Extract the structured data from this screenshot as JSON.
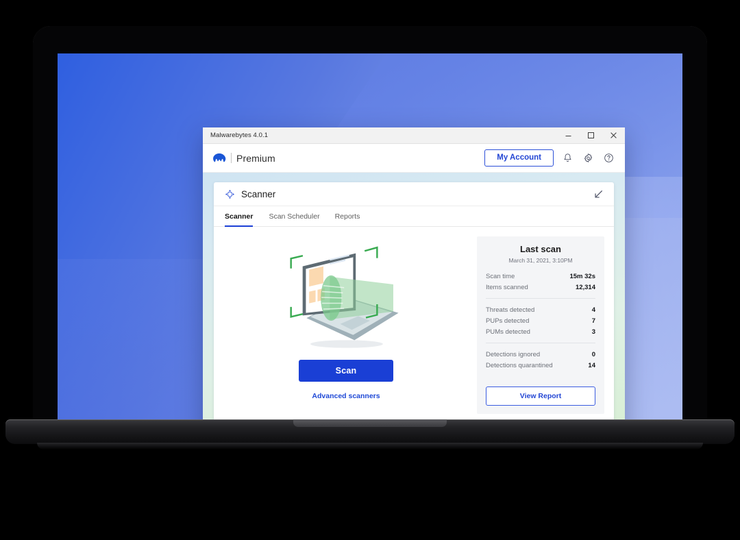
{
  "window": {
    "title": "Malwarebytes 4.0.1",
    "controls": {
      "minimize": "minimize-icon",
      "maximize": "maximize-icon",
      "close": "close-icon"
    }
  },
  "header": {
    "logo_icon": "malwarebytes-logo-icon",
    "edition": "Premium",
    "my_account_label": "My Account",
    "icons": {
      "notifications": "bell-icon",
      "settings": "gear-icon",
      "help": "help-circle-icon"
    }
  },
  "scanner_panel": {
    "icon": "scanner-target-icon",
    "title": "Scanner",
    "collapse_icon": "collapse-arrow-icon",
    "tabs": [
      {
        "label": "Scanner",
        "active": true
      },
      {
        "label": "Scan Scheduler",
        "active": false
      },
      {
        "label": "Reports",
        "active": false
      }
    ],
    "illustration": "laptop-scan-illustration",
    "scan_button_label": "Scan",
    "advanced_scanners_label": "Advanced scanners"
  },
  "last_scan": {
    "title": "Last scan",
    "timestamp": "March 31, 2021,  3:10PM",
    "groups": [
      {
        "rows": [
          {
            "label": "Scan time",
            "value": "15m 32s"
          },
          {
            "label": "Items scanned",
            "value": "12,314"
          }
        ]
      },
      {
        "rows": [
          {
            "label": "Threats detected",
            "value": "4"
          },
          {
            "label": "PUPs detected",
            "value": "7"
          },
          {
            "label": "PUMs detected",
            "value": "3"
          }
        ]
      },
      {
        "rows": [
          {
            "label": "Detections ignored",
            "value": "0"
          },
          {
            "label": "Detections quarantined",
            "value": "14"
          }
        ]
      }
    ],
    "view_report_label": "View Report"
  },
  "colors": {
    "brand_blue": "#1a3fd5",
    "accent_link": "#2346d4",
    "scan_green": "#3aa34a",
    "panel_bg": "#f4f5f7"
  }
}
